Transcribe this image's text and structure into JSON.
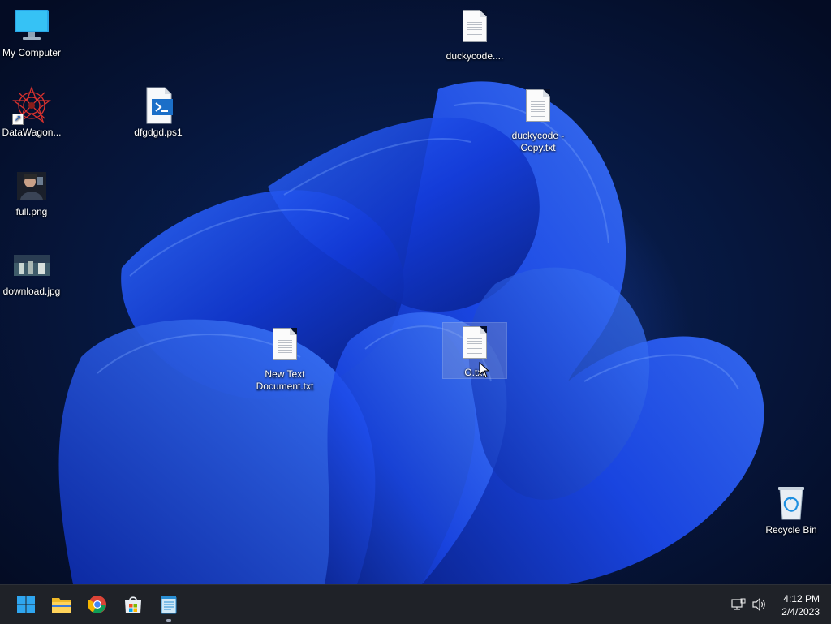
{
  "desktop": {
    "icons": [
      {
        "name": "my-computer",
        "label": "My Computer",
        "kind": "monitor-icon"
      },
      {
        "name": "datawagon",
        "label": "DataWagon...",
        "kind": "shortcut-icon"
      },
      {
        "name": "full-png",
        "label": "full.png",
        "kind": "image-thumbnail-icon"
      },
      {
        "name": "download-jpg",
        "label": "download.jpg",
        "kind": "image-thumbnail-icon"
      },
      {
        "name": "dfgdgd-ps1",
        "label": "dfgdgd.ps1",
        "kind": "powershell-file-icon"
      },
      {
        "name": "duckycode",
        "label": "duckycode....",
        "kind": "text-file-icon"
      },
      {
        "name": "duckycode-copy",
        "label": "duckycode - Copy.txt",
        "kind": "text-file-icon"
      },
      {
        "name": "new-text-document",
        "label": "New Text Document.txt",
        "kind": "text-file-icon"
      },
      {
        "name": "o-txt",
        "label": "O.txt",
        "kind": "text-file-icon",
        "selected": true
      },
      {
        "name": "recycle-bin",
        "label": "Recycle Bin",
        "kind": "recycle-bin-icon"
      }
    ]
  },
  "taskbar": {
    "pinned": [
      {
        "name": "start",
        "icon": "windows-logo-icon"
      },
      {
        "name": "file-explorer",
        "icon": "folder-icon"
      },
      {
        "name": "chrome",
        "icon": "chrome-icon"
      },
      {
        "name": "store",
        "icon": "microsoft-store-icon"
      },
      {
        "name": "notepad",
        "icon": "notepad-icon",
        "active": true
      }
    ],
    "tray": {
      "network_icon": "network-icon",
      "volume_icon": "volume-icon",
      "time": "4:12 PM",
      "date": "2/4/2023"
    }
  },
  "colors": {
    "taskbar_bg": "#1f2228",
    "accent": "#1e6fff",
    "desktop_bg": "#06102a"
  }
}
